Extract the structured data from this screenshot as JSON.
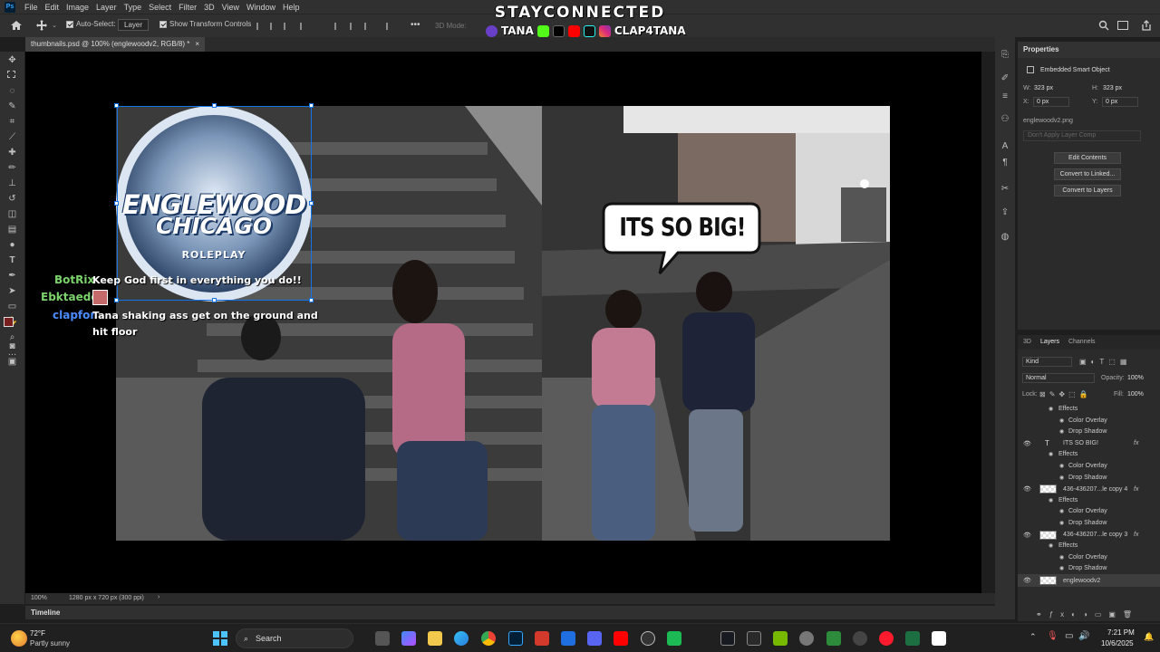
{
  "app": {
    "logo": "Ps",
    "menu": [
      "File",
      "Edit",
      "Image",
      "Layer",
      "Type",
      "Select",
      "Filter",
      "3D",
      "View",
      "Window",
      "Help"
    ]
  },
  "options": {
    "auto_select_label": "Auto-Select:",
    "auto_select_value": "Layer",
    "transform_label": "Show Transform Controls",
    "mode_3d": "3D Mode:",
    "more": "•••"
  },
  "overlay": {
    "brand": "STAYCONNECTED",
    "handle1": "TANA",
    "handle2": "CLAP4TANA"
  },
  "document": {
    "tab_title": "thumbnails.psd @ 100% (englewoodv2, RGB/8) *",
    "tab_close": "×",
    "zoom": "100%",
    "doc_info": "1280 px x 720 px (300 ppi)",
    "status_arrow": "›",
    "timeline": "Timeline"
  },
  "artwork": {
    "logo_line1": "ENGLEWOOD",
    "logo_line2": "CHICAGO",
    "logo_line3": "ROLEPLAY",
    "speech_bubble": "ITS SO BIG!"
  },
  "chat": [
    {
      "name": "BotRix",
      "color": "#7bd36b",
      "message": "Keep God first in everything you do!!"
    },
    {
      "name": "Ebktaedo",
      "color": "#7bd36b",
      "message": ""
    },
    {
      "name": "clapfor",
      "color": "#4a8cff",
      "message": "Tana shaking ass get on the ground and hit floor"
    }
  ],
  "properties": {
    "title": "Properties",
    "object_type": "Embedded Smart Object",
    "w_label": "W:",
    "w_value": "323 px",
    "h_label": "H:",
    "h_value": "323 px",
    "x_label": "X:",
    "x_value": "0 px",
    "y_label": "Y:",
    "y_value": "0 px",
    "filename": "englewoodv2.png",
    "layer_comp": "Don't Apply Layer Comp",
    "buttons": [
      "Edit Contents",
      "Convert to Linked...",
      "Convert to Layers"
    ]
  },
  "layers": {
    "tabs": [
      "3D",
      "Layers",
      "Channels"
    ],
    "filter": "Kind",
    "blend_mode": "Normal",
    "opacity_label": "Opacity:",
    "opacity_value": "100%",
    "lock_label": "Lock:",
    "fill_label": "Fill:",
    "fill_value": "100%",
    "rows": [
      {
        "kind": "effects",
        "label": "Effects"
      },
      {
        "kind": "effect",
        "label": "Color Overlay"
      },
      {
        "kind": "effect",
        "label": "Drop Shadow"
      },
      {
        "kind": "layer",
        "type": "T",
        "label": "ITS SO BIG!",
        "fx": "fx"
      },
      {
        "kind": "effects",
        "label": "Effects"
      },
      {
        "kind": "effect",
        "label": "Color Overlay"
      },
      {
        "kind": "effect",
        "label": "Drop Shadow"
      },
      {
        "kind": "layer",
        "type": "img",
        "label": "436-436207...le copy 4",
        "fx": "fx"
      },
      {
        "kind": "effects",
        "label": "Effects"
      },
      {
        "kind": "effect",
        "label": "Color Overlay"
      },
      {
        "kind": "effect",
        "label": "Drop Shadow"
      },
      {
        "kind": "layer",
        "type": "img",
        "label": "436-436207...le copy 3",
        "fx": "fx"
      },
      {
        "kind": "effects",
        "label": "Effects"
      },
      {
        "kind": "effect",
        "label": "Color Overlay"
      },
      {
        "kind": "effect",
        "label": "Drop Shadow"
      },
      {
        "kind": "layer",
        "type": "smart",
        "label": "englewoodv2",
        "fx": ""
      }
    ]
  },
  "taskbar": {
    "weather_temp": "72°F",
    "weather_desc": "Partly sunny",
    "search": "Search",
    "time": "7:21 PM",
    "date": "10/6/2025",
    "colors": {
      "accent": "#31a8ff"
    }
  }
}
